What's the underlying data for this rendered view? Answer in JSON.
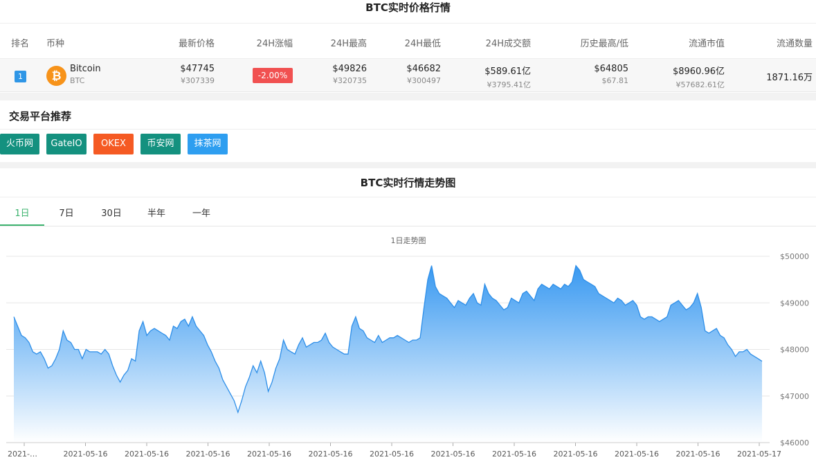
{
  "price_section": {
    "title": "BTC实时价格行情"
  },
  "table": {
    "headers": [
      "排名",
      "币种",
      "最新价格",
      "24H涨幅",
      "24H最高",
      "24H最低",
      "24H成交额",
      "历史最高/低",
      "流通市值",
      "流通数量"
    ],
    "row": {
      "rank": "1",
      "name": "Bitcoin",
      "symbol": "BTC",
      "price_usd": "$47745",
      "price_cny": "¥307339",
      "change_24h": "-2.00%",
      "high_usd": "$49826",
      "high_cny": "¥320735",
      "low_usd": "$46682",
      "low_cny": "¥300497",
      "volume_usd": "$589.61亿",
      "volume_cny": "¥3795.41亿",
      "ath": "$64805",
      "atl": "$67.81",
      "mcap_usd": "$8960.96亿",
      "mcap_cny": "¥57682.61亿",
      "supply": "1871.16万"
    }
  },
  "exchanges": {
    "title": "交易平台推荐",
    "buttons": [
      {
        "label": "火币网",
        "color": "#14917f"
      },
      {
        "label": "GateIO",
        "color": "#14917f"
      },
      {
        "label": "OKEX",
        "color": "#f55a23"
      },
      {
        "label": "币安网",
        "color": "#14917f"
      },
      {
        "label": "抹茶网",
        "color": "#2e9ef0"
      }
    ]
  },
  "trend": {
    "title": "BTC实时行情走势图",
    "tabs": [
      "1日",
      "7日",
      "30日",
      "半年",
      "一年"
    ],
    "active_tab": "1日"
  },
  "colors": {
    "line": "#2d8ee8",
    "fill_top": "#2f94f0",
    "fill_bottom": "#ffffff",
    "change_down": "#f15151",
    "tab_active": "#3db36f",
    "rank": "#2f96e6"
  },
  "chart_data": {
    "type": "area",
    "title": "1日走势图",
    "ylim": [
      46000,
      50000
    ],
    "y_ticks": [
      "$46000",
      "$47000",
      "$48000",
      "$49000",
      "$50000"
    ],
    "x_tick_labels": [
      "2021-…",
      "2021-05-16",
      "2021-05-16",
      "2021-05-16",
      "2021-05-16",
      "2021-05-16",
      "2021-05-16",
      "2021-05-16",
      "2021-05-16",
      "2021-05-16",
      "2021-05-16",
      "2021-05-16",
      "2021-05-17"
    ],
    "grid": true,
    "series": [
      {
        "values": [
          48700,
          48500,
          48300,
          48250,
          48150,
          47950,
          47900,
          47950,
          47800,
          47600,
          47650,
          47800,
          48000,
          48400,
          48200,
          48150,
          48000,
          48000,
          47800,
          48000,
          47950,
          47950,
          47950,
          47900,
          48000,
          47900,
          47650,
          47450,
          47300,
          47450,
          47550,
          47800,
          47750,
          48400,
          48600,
          48300,
          48400,
          48450,
          48400,
          48350,
          48300,
          48200,
          48500,
          48450,
          48600,
          48650,
          48500,
          48700,
          48500,
          48400,
          48300,
          48100,
          47950,
          47750,
          47600,
          47350,
          47200,
          47050,
          46900,
          46650,
          46900,
          47200,
          47400,
          47650,
          47500,
          47750,
          47500,
          47100,
          47300,
          47600,
          47800,
          48200,
          48000,
          47950,
          47900,
          48100,
          48250,
          48050,
          48100,
          48150,
          48150,
          48200,
          48350,
          48150,
          48050,
          48000,
          47950,
          47900,
          47900,
          48500,
          48700,
          48450,
          48400,
          48250,
          48200,
          48150,
          48300,
          48150,
          48200,
          48250,
          48250,
          48300,
          48250,
          48200,
          48150,
          48200,
          48200,
          48250,
          48900,
          49500,
          49800,
          49350,
          49200,
          49150,
          49100,
          49000,
          48900,
          49050,
          49000,
          48950,
          49100,
          49200,
          49000,
          48950,
          49400,
          49200,
          49100,
          49050,
          48950,
          48850,
          48900,
          49100,
          49050,
          49000,
          49200,
          49250,
          49150,
          49050,
          49300,
          49400,
          49350,
          49300,
          49400,
          49350,
          49300,
          49400,
          49350,
          49450,
          49800,
          49700,
          49500,
          49450,
          49400,
          49350,
          49200,
          49150,
          49100,
          49050,
          49000,
          49100,
          49050,
          48950,
          49000,
          49050,
          48950,
          48700,
          48650,
          48700,
          48700,
          48650,
          48600,
          48650,
          48700,
          48950,
          49000,
          49050,
          48950,
          48850,
          48900,
          49000,
          49200,
          48900,
          48400,
          48350,
          48400,
          48450,
          48300,
          48250,
          48100,
          48000,
          47850,
          47950,
          47950,
          48000,
          47900,
          47850,
          47800,
          47745
        ]
      }
    ]
  }
}
